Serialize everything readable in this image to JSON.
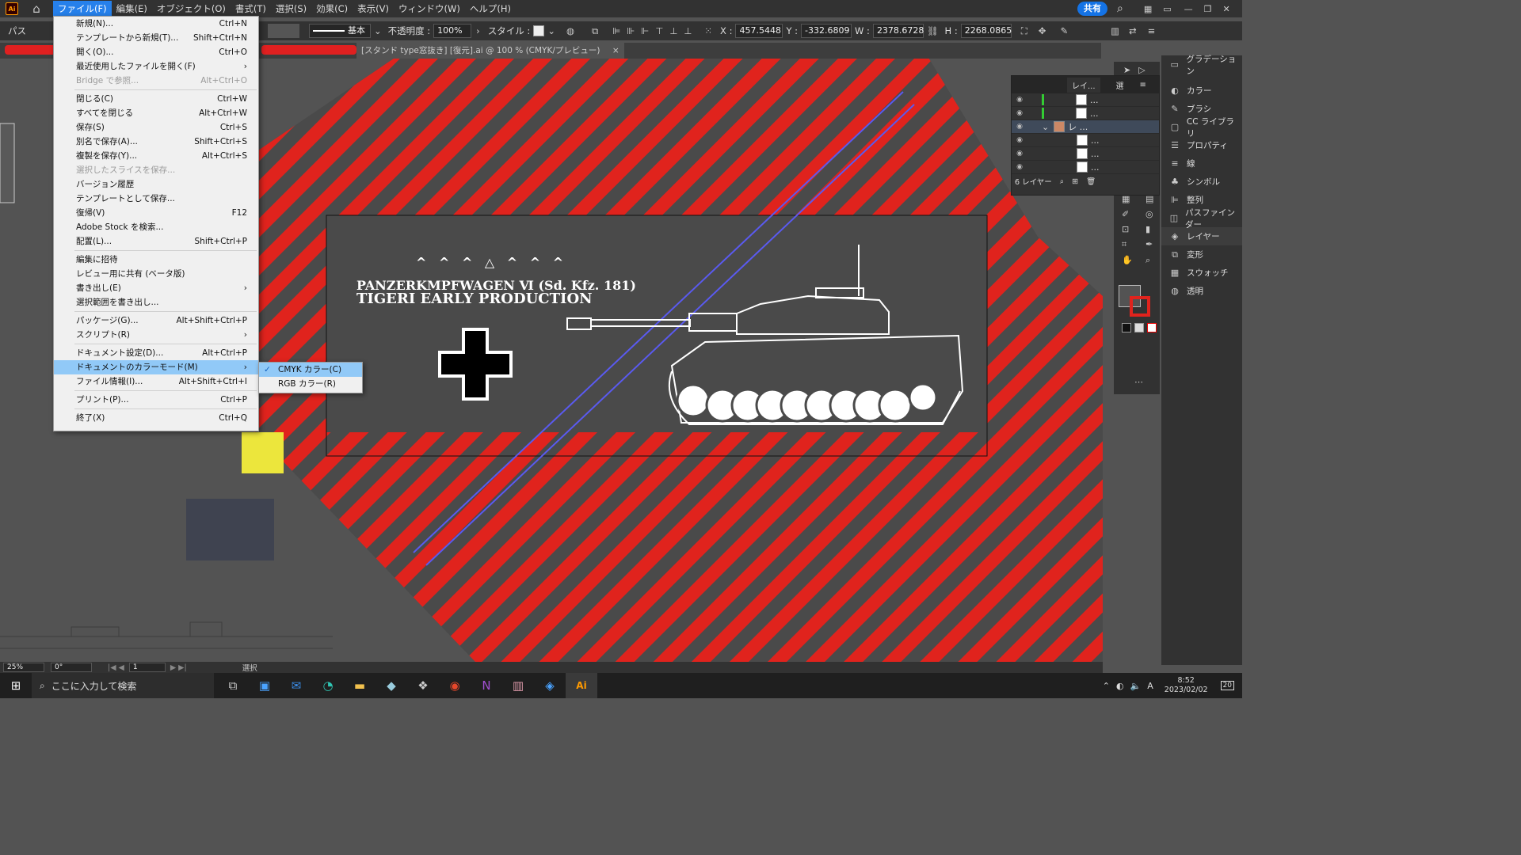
{
  "app": {
    "logo": "Ai",
    "home_icon": "home-icon"
  },
  "menubar": {
    "items": [
      "ファイル(F)",
      "編集(E)",
      "オブジェクト(O)",
      "書式(T)",
      "選択(S)",
      "効果(C)",
      "表示(V)",
      "ウィンドウ(W)",
      "ヘルプ(H)"
    ],
    "share_label": "共有"
  },
  "controlbar": {
    "selection_label": "パス",
    "stroke_style": "基本",
    "opacity_label": "不透明度 :",
    "opacity_value": "100%",
    "style_label": "スタイル :",
    "x_label": "X :",
    "x_value": "457.5448",
    "y_label": "Y :",
    "y_value": "-332.6809",
    "w_label": "W :",
    "w_value": "2378.6728",
    "h_label": "H :",
    "h_value": "2268.0865"
  },
  "document_tab": {
    "title": "[スタンド type窓抜き] [復元].ai @ 100 % (CMYK/プレビュー)",
    "close": "×"
  },
  "artwork": {
    "title_line1": "PANZERKMPFWAGEN Ⅵ (Sd. Kfz. 181)",
    "title_line2": "TIGERⅠ EARLY PRODUCTION",
    "chevrons": "^ ^ ^ △ ^ ^ ^"
  },
  "file_menu": {
    "groups": [
      [
        {
          "label": "新規(N)...",
          "shortcut": "Ctrl+N"
        },
        {
          "label": "テンプレートから新規(T)...",
          "shortcut": "Shift+Ctrl+N"
        },
        {
          "label": "開く(O)...",
          "shortcut": "Ctrl+O"
        },
        {
          "label": "最近使用したファイルを開く(F)",
          "shortcut": "›"
        },
        {
          "label": "Bridge で参照...",
          "shortcut": "Alt+Ctrl+O",
          "disabled": true
        }
      ],
      [
        {
          "label": "閉じる(C)",
          "shortcut": "Ctrl+W"
        },
        {
          "label": "すべてを閉じる",
          "shortcut": "Alt+Ctrl+W"
        },
        {
          "label": "保存(S)",
          "shortcut": "Ctrl+S"
        },
        {
          "label": "別名で保存(A)...",
          "shortcut": "Shift+Ctrl+S"
        },
        {
          "label": "複製を保存(Y)...",
          "shortcut": "Alt+Ctrl+S"
        },
        {
          "label": "選択したスライスを保存...",
          "shortcut": "",
          "disabled": true
        },
        {
          "label": "バージョン履歴",
          "shortcut": ""
        },
        {
          "label": "テンプレートとして保存...",
          "shortcut": ""
        },
        {
          "label": "復帰(V)",
          "shortcut": "F12"
        },
        {
          "label": "Adobe Stock を検索...",
          "shortcut": ""
        },
        {
          "label": "配置(L)...",
          "shortcut": "Shift+Ctrl+P"
        }
      ],
      [
        {
          "label": "編集に招待",
          "shortcut": ""
        },
        {
          "label": "レビュー用に共有 (ベータ版)",
          "shortcut": ""
        },
        {
          "label": "書き出し(E)",
          "shortcut": "›"
        },
        {
          "label": "選択範囲を書き出し...",
          "shortcut": ""
        }
      ],
      [
        {
          "label": "パッケージ(G)...",
          "shortcut": "Alt+Shift+Ctrl+P"
        },
        {
          "label": "スクリプト(R)",
          "shortcut": "›"
        }
      ],
      [
        {
          "label": "ドキュメント設定(D)...",
          "shortcut": "Alt+Ctrl+P"
        },
        {
          "label": "ドキュメントのカラーモード(M)",
          "shortcut": "›",
          "highlighted": true
        },
        {
          "label": "ファイル情報(I)...",
          "shortcut": "Alt+Shift+Ctrl+I"
        }
      ],
      [
        {
          "label": "プリント(P)...",
          "shortcut": "Ctrl+P"
        }
      ],
      [
        {
          "label": "終了(X)",
          "shortcut": "Ctrl+Q"
        }
      ]
    ]
  },
  "color_mode_submenu": {
    "items": [
      {
        "label": "CMYK カラー(C)",
        "checked": true
      },
      {
        "label": "RGB カラー(R)",
        "checked": false
      }
    ]
  },
  "layers_panel": {
    "tab": "レイ...",
    "tab2": "選",
    "footer": "6 レイヤー",
    "rows": [
      "...",
      "...",
      "レ ...",
      "...",
      "...",
      "..."
    ]
  },
  "right_panels": {
    "items": [
      "グラデーション",
      "カラー",
      "ブラシ",
      "CC ライブラリ",
      "プロパティ",
      "線",
      "シンボル",
      "整列",
      "パスファインダー",
      "レイヤー",
      "変形",
      "スウォッチ",
      "透明"
    ],
    "active": "レイヤー"
  },
  "statusbar": {
    "zoom": "25%",
    "rotate": "0°",
    "artboard": "1",
    "mode": "選択"
  },
  "taskbar": {
    "search_placeholder": "ここに入力して検索",
    "ime": "A",
    "time": "8:52",
    "date": "2023/02/02",
    "notifications": "20"
  },
  "colors": {
    "stripe_red": "#e0231d",
    "dark_gray": "#535353",
    "accent": "#1473e6",
    "menu_highlight": "#91c9f7"
  }
}
